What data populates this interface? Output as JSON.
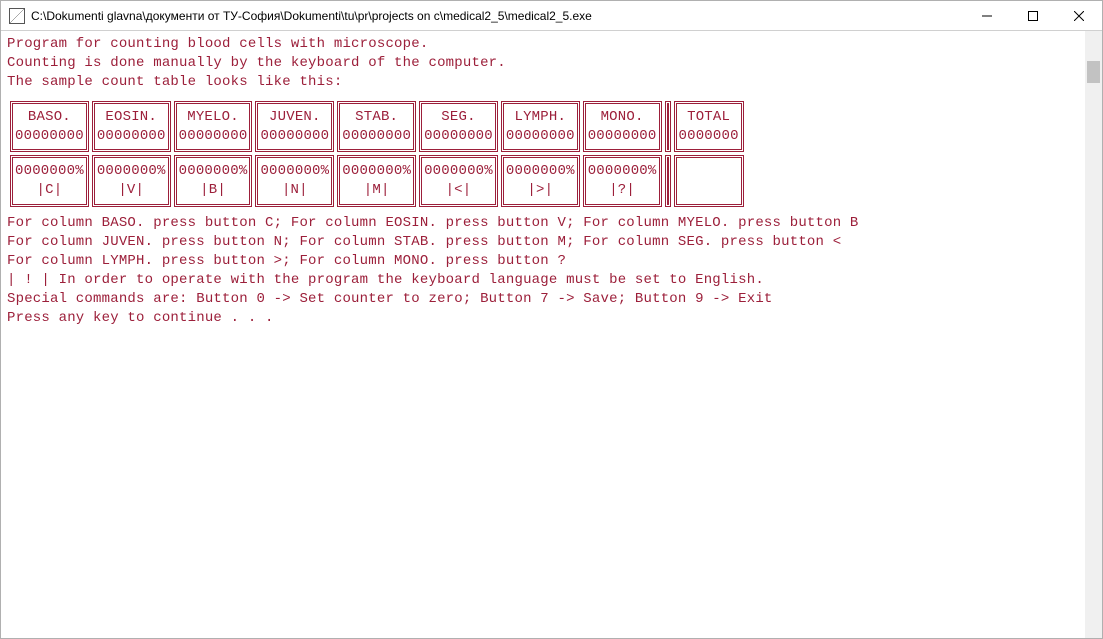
{
  "window": {
    "title": "C:\\Dokumenti glavna\\документи от ТУ-София\\Dokumenti\\tu\\pr\\projects on c\\medical2_5\\medical2_5.exe"
  },
  "intro": {
    "line1": "Program for counting blood cells with microscope.",
    "line2": "Counting is done manually by the keyboard of the computer.",
    "line3": "The sample count table looks like this:"
  },
  "table": {
    "columns": [
      {
        "header": "BASO.",
        "count": "00000000",
        "pct": "0000000%",
        "key": "|C|"
      },
      {
        "header": "EOSIN.",
        "count": "00000000",
        "pct": "0000000%",
        "key": "|V|"
      },
      {
        "header": "MYELO.",
        "count": "00000000",
        "pct": "0000000%",
        "key": "|B|"
      },
      {
        "header": "JUVEN.",
        "count": "00000000",
        "pct": "0000000%",
        "key": "|N|"
      },
      {
        "header": "STAB.",
        "count": "00000000",
        "pct": "0000000%",
        "key": "|M|"
      },
      {
        "header": "SEG.",
        "count": "00000000",
        "pct": "0000000%",
        "key": "|<|"
      },
      {
        "header": "LYMPH.",
        "count": "00000000",
        "pct": "0000000%",
        "key": "|>|"
      },
      {
        "header": "MONO.",
        "count": "00000000",
        "pct": "0000000%",
        "key": "|?|"
      }
    ],
    "total": {
      "header": "TOTAL",
      "count": "0000000"
    }
  },
  "instructions": {
    "l1": "For column BASO. press button C; For column EOSIN. press button V; For column MYELO. press button B",
    "l2": "For column JUVEN. press button N; For column STAB. press button M; For column SEG. press button <",
    "l3": "For column LYMPH. press button >; For column MONO. press button ?",
    "l4": "| ! | In order to operate with the program the keyboard language must be set to English.",
    "l5": "Special commands are: Button 0 -> Set counter to zero; Button 7 -> Save; Button 9 -> Exit",
    "l6": "Press any key to continue . . ."
  }
}
